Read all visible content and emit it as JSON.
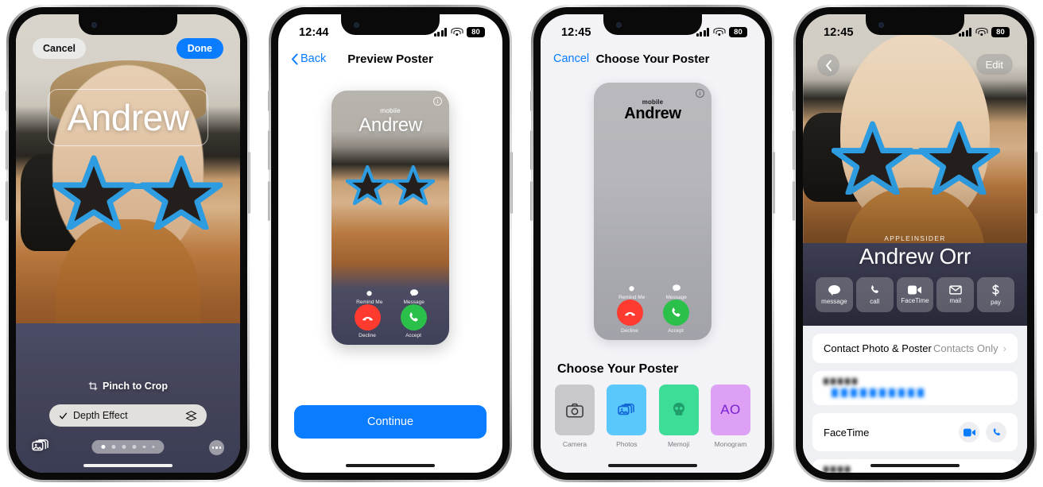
{
  "phones": [
    {
      "id": "poster-editor",
      "name": "contact-poster-editor",
      "statusbar": {
        "visible": false,
        "time": "",
        "battery": ""
      },
      "cancel_label": "Cancel",
      "done_label": "Done",
      "contact_name": "Andrew",
      "pinch_hint": "Pinch to Crop",
      "depth_effect_label": "Depth Effect",
      "depth_effect_checked": true,
      "page_dots": 6,
      "active_dot": 1,
      "icons": {
        "crop": "crop-icon",
        "check": "checkmark-icon",
        "layers": "layers-icon",
        "photos": "photo-stack-icon",
        "more": "ellipsis-icon"
      }
    },
    {
      "id": "preview-poster",
      "name": "preview-poster-screen",
      "statusbar": {
        "visible": true,
        "time": "12:44",
        "battery": "80"
      },
      "nav": {
        "back_label": "Back",
        "title": "Preview Poster"
      },
      "poster": {
        "label": "mobile",
        "contact_name": "Andrew",
        "info_icon": "info-circle-icon",
        "actions": [
          {
            "label": "Remind Me",
            "icon": "alarm-icon"
          },
          {
            "label": "Message",
            "icon": "message-bubble-icon"
          }
        ],
        "calls": [
          {
            "label": "Decline",
            "icon": "phone-down-icon",
            "color": "#ff3b30"
          },
          {
            "label": "Accept",
            "icon": "phone-icon",
            "color": "#2bc04a"
          }
        ]
      },
      "continue_label": "Continue"
    },
    {
      "id": "choose-poster",
      "name": "choose-your-poster-screen",
      "statusbar": {
        "visible": true,
        "time": "12:45",
        "battery": "80"
      },
      "nav": {
        "cancel_label": "Cancel",
        "title": "Choose Your Poster"
      },
      "poster": {
        "label": "mobile",
        "contact_name": "Andrew",
        "info_icon": "info-circle-icon",
        "actions": [
          {
            "label": "Remind Me",
            "icon": "alarm-icon"
          },
          {
            "label": "Message",
            "icon": "message-bubble-icon"
          }
        ],
        "calls": [
          {
            "label": "Decline",
            "icon": "phone-down-icon",
            "color": "#ff3b30"
          },
          {
            "label": "Accept",
            "icon": "phone-icon",
            "color": "#2bc04a"
          }
        ]
      },
      "section_heading": "Choose Your Poster",
      "tiles": [
        {
          "label": "Camera",
          "icon": "camera-icon",
          "bg": "#c7c7cc",
          "fg": "#3a3a3c",
          "text": ""
        },
        {
          "label": "Photos",
          "icon": "photo-stack-icon",
          "bg": "#5ac8fa",
          "fg": "#1266d6",
          "text": ""
        },
        {
          "label": "Memoji",
          "icon": "memoji-icon",
          "bg": "#3ddc97",
          "fg": "#1f9e6b",
          "text": ""
        },
        {
          "label": "Monogram",
          "icon": "monogram-icon",
          "bg": "#dda0f5",
          "fg": "#7a1fd0",
          "text": "AO"
        }
      ]
    },
    {
      "id": "contact-card",
      "name": "contact-detail-screen",
      "statusbar": {
        "visible": true,
        "time": "12:45",
        "battery": "80"
      },
      "back_icon": "chevron-left-icon",
      "edit_label": "Edit",
      "organization": "APPLEINSIDER",
      "contact_name": "Andrew Orr",
      "actions": [
        {
          "label": "message",
          "icon": "message-bubble-icon"
        },
        {
          "label": "call",
          "icon": "phone-icon"
        },
        {
          "label": "FaceTime",
          "icon": "video-camera-icon"
        },
        {
          "label": "mail",
          "icon": "envelope-icon"
        },
        {
          "label": "pay",
          "icon": "dollar-sign-icon"
        }
      ],
      "rows": [
        {
          "type": "value",
          "key": "Contact Photo & Poster",
          "value": "Contacts Only",
          "chevron": true
        },
        {
          "type": "redacted-phone"
        },
        {
          "type": "facetime",
          "key": "FaceTime",
          "icons": [
            "video-camera-icon",
            "phone-icon"
          ]
        },
        {
          "type": "redacted-email"
        }
      ]
    }
  ],
  "colors": {
    "accent_blue": "#0a7cff",
    "decline_red": "#ff3b30",
    "accept_green": "#2bc04a",
    "list_bg": "#eff0f4",
    "screen_bg_light": "#f2f2f7"
  }
}
